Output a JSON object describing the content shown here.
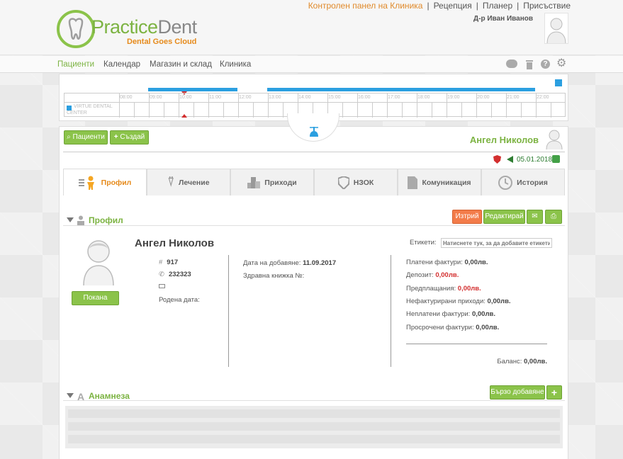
{
  "header": {
    "brand_part1": "Practice",
    "brand_part2": "Dent",
    "tagline": "Dental Goes Cloud",
    "top_links": [
      "Контролен панел на Клиника",
      "Рецепция",
      "Планер",
      "Присъствие"
    ],
    "separator": "|",
    "user_name": "Д-р Иван Иванов"
  },
  "nav": {
    "items": [
      "Пациенти",
      "Календар",
      "Магазин и склад",
      "Клиника"
    ]
  },
  "timeline": {
    "hours": [
      "08:00",
      "09:00",
      "10:00",
      "11:00",
      "12:00",
      "13:00",
      "14:00",
      "15:00",
      "16:00",
      "17:00",
      "18:00",
      "19:00",
      "20:00",
      "21:00",
      "22:00"
    ],
    "room_line1": "VIRTUE DENTAL",
    "room_line2": "CENTER",
    "accent_color": "#2b9fe0"
  },
  "toolbar": {
    "patients_button": "Пациенти",
    "create_button": "Създай",
    "patient_name": "Ангел Николов",
    "last_visit_date": "05.01.2018"
  },
  "tabs": [
    "Профил",
    "Лечение",
    "Приходи",
    "НЗОК",
    "Комуникация",
    "История"
  ],
  "profile": {
    "section_title": "Профил",
    "delete_button": "Изтрий",
    "edit_button": "Редактирай",
    "name": "Ангел Николов",
    "id_number": "917",
    "phone": "232323",
    "email": "",
    "birthdate_label": "Родена дата:",
    "invite_button": "Покана",
    "added_label": "Дата на добавяне:",
    "added_value": "11.09.2017",
    "health_book_label": "Здравна книжка №:",
    "labels_label": "Етикети:",
    "labels_placeholder": "Натиснете тук, за да добавите етикети",
    "finance": [
      {
        "label": "Платени фактури:",
        "value": "0,00лв."
      },
      {
        "label": "Депозит:",
        "value": "0,00лв."
      },
      {
        "label": "Предплащания:",
        "value": "0,00лв."
      },
      {
        "label": "Нефактурирани приходи:",
        "value": "0,00лв."
      },
      {
        "label": "Неплатени фактури:",
        "value": "0,00лв."
      },
      {
        "label": "Просрочени фактури:",
        "value": "0,00лв."
      }
    ],
    "balance_label": "Баланс:",
    "balance_value": "0,00лв."
  },
  "anamnesis": {
    "section_title": "Анамнеза",
    "quick_add_button": "Бързо добавяне"
  },
  "colors": {
    "green": "#8bc34a",
    "orange": "#e68a1b",
    "red": "#d32f2f",
    "blue": "#2b9fe0"
  }
}
